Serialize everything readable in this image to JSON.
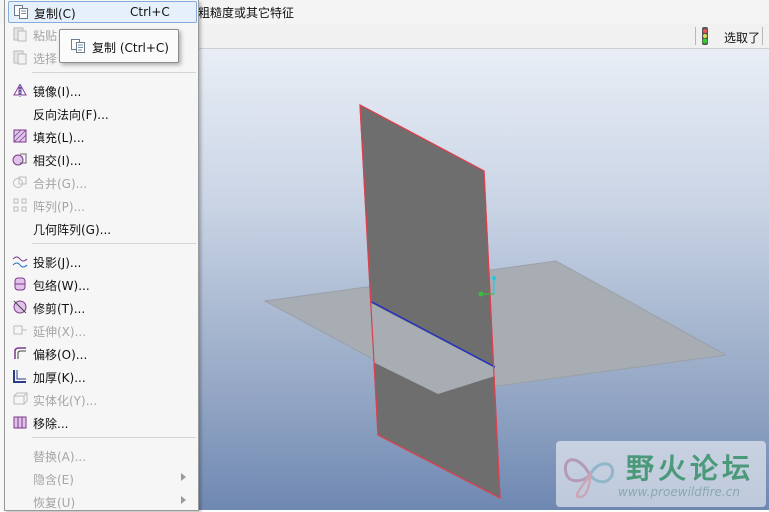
{
  "topbar": {
    "hint": "粗糙度或其它特征"
  },
  "toolbar": {
    "filter_label": "选取了"
  },
  "menu": {
    "items": [
      {
        "label": "复制(C)",
        "shortcut": "Ctrl+C",
        "icon": "copy-icon",
        "enabled": true,
        "selected": true
      },
      {
        "label": "粘贴",
        "icon": "paste-icon",
        "enabled": false
      },
      {
        "label": "选择",
        "icon": "paste-special-icon",
        "enabled": false
      },
      {
        "label": "镜像(I)...",
        "icon": "mirror-icon",
        "enabled": true
      },
      {
        "label": "反向法向(F)...",
        "icon": "",
        "enabled": true
      },
      {
        "label": "填充(L)...",
        "icon": "fill-icon",
        "enabled": true
      },
      {
        "label": "相交(I)...",
        "icon": "intersect-icon",
        "enabled": true
      },
      {
        "label": "合并(G)...",
        "icon": "merge-icon",
        "enabled": false
      },
      {
        "label": "阵列(P)...",
        "icon": "pattern-icon",
        "enabled": false
      },
      {
        "label": "几何阵列(G)...",
        "icon": "",
        "enabled": true
      },
      {
        "label": "投影(J)...",
        "icon": "project-icon",
        "enabled": true
      },
      {
        "label": "包络(W)...",
        "icon": "wrap-icon",
        "enabled": true
      },
      {
        "label": "修剪(T)...",
        "icon": "trim-icon",
        "enabled": true
      },
      {
        "label": "延伸(X)...",
        "icon": "extend-icon",
        "enabled": false
      },
      {
        "label": "偏移(O)...",
        "icon": "offset-icon",
        "enabled": true
      },
      {
        "label": "加厚(K)...",
        "icon": "thicken-icon",
        "enabled": true
      },
      {
        "label": "实体化(Y)...",
        "icon": "solidify-icon",
        "enabled": false
      },
      {
        "label": "移除...",
        "icon": "remove-icon",
        "enabled": true
      },
      {
        "label": "替换(A)...",
        "icon": "",
        "enabled": false
      },
      {
        "label": "隐含(E)",
        "icon": "",
        "enabled": false,
        "submenu": true
      },
      {
        "label": "恢复(U)",
        "icon": "",
        "enabled": false,
        "submenu": true
      }
    ]
  },
  "tooltip": {
    "text": "复制 (Ctrl+C)",
    "icon": "copy-icon"
  },
  "watermark": {
    "title": "野火论坛",
    "url": "www.proewildfire.cn"
  },
  "colors": {
    "accent": "#84acdd",
    "surface": "#6e6e6e",
    "plane": "#a8adb4",
    "edge": "#d8434f"
  }
}
